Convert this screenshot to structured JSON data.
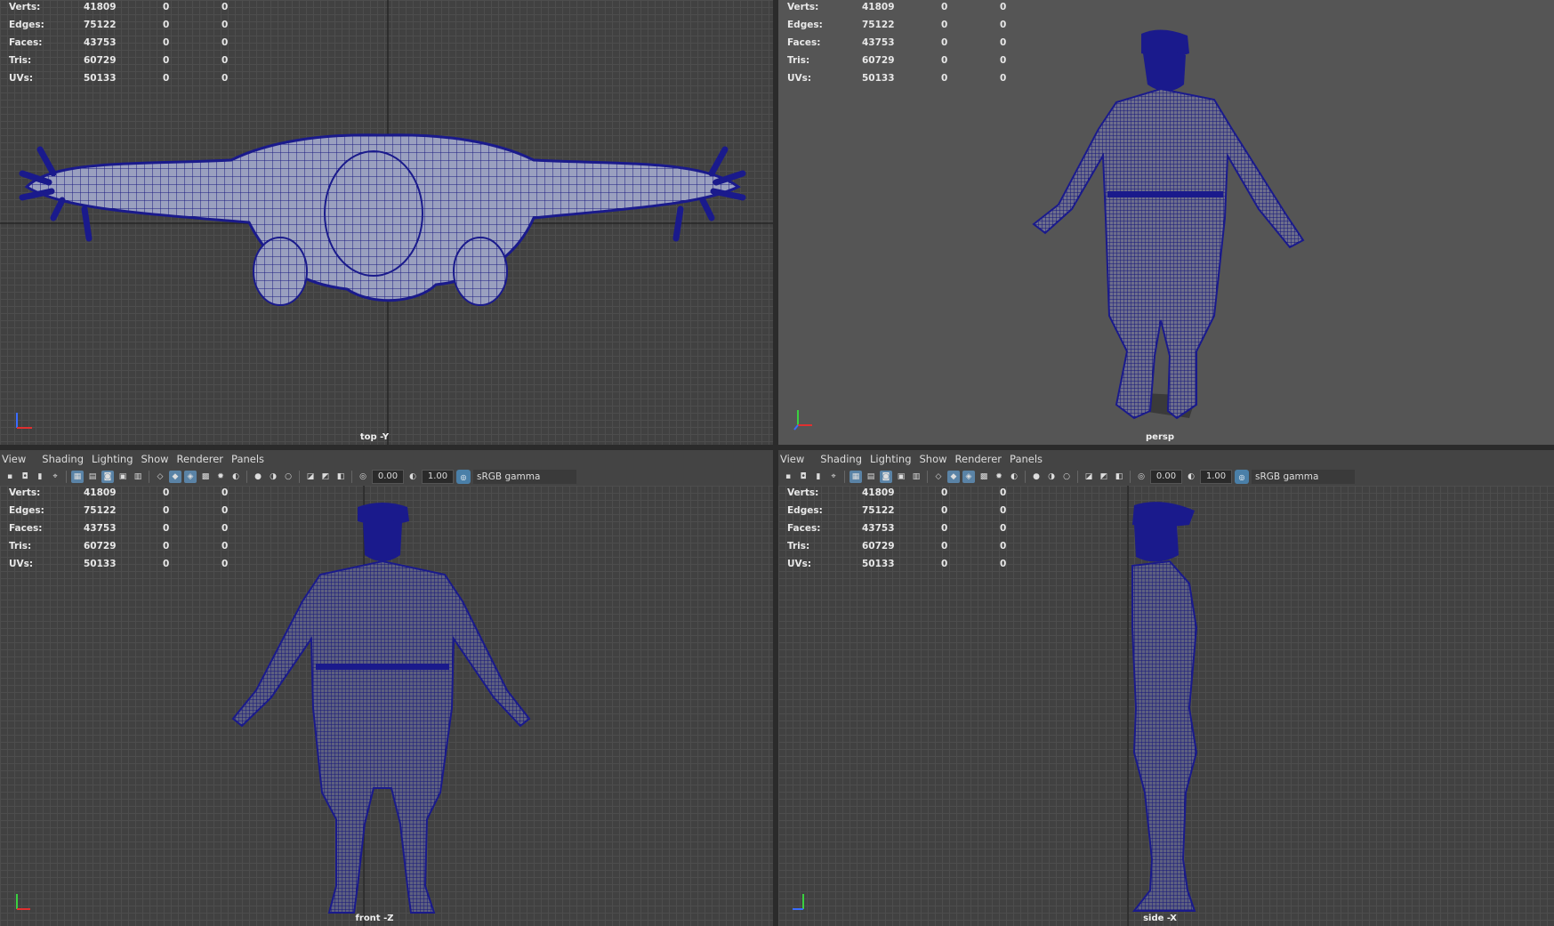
{
  "stats": {
    "rows": [
      {
        "label": "Verts:",
        "total": "41809",
        "selected": "0",
        "extra": "0"
      },
      {
        "label": "Edges:",
        "total": "75122",
        "selected": "0",
        "extra": "0"
      },
      {
        "label": "Faces:",
        "total": "43753",
        "selected": "0",
        "extra": "0"
      },
      {
        "label": "Tris:",
        "total": "60729",
        "selected": "0",
        "extra": "0"
      },
      {
        "label": "UVs:",
        "total": "50133",
        "selected": "0",
        "extra": "0"
      }
    ]
  },
  "viewports": {
    "top": {
      "camera": "top -Y"
    },
    "persp": {
      "camera": "persp"
    },
    "front": {
      "camera": "front -Z"
    },
    "side": {
      "camera": "side -X"
    }
  },
  "menu": [
    "View",
    "Shading",
    "Lighting",
    "Show",
    "Renderer",
    "Panels"
  ],
  "toolbar": {
    "exposure": "0.00",
    "gamma_value": "1.00",
    "color_space": "sRGB gamma"
  },
  "colors": {
    "wireframe": "#1a1a8c",
    "viewport_bg": "#414141",
    "persp_bg": "#555555",
    "toolbar_active": "#5a83a6"
  }
}
